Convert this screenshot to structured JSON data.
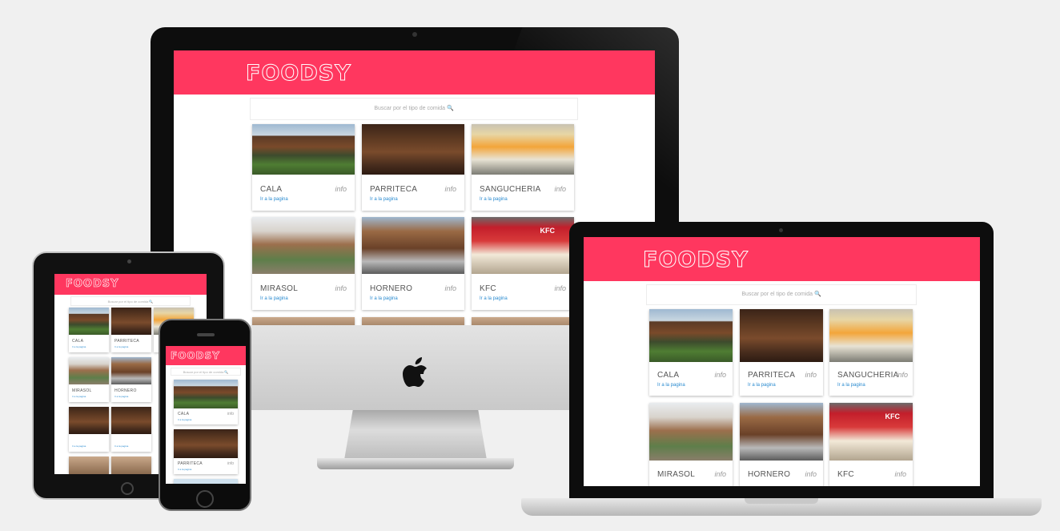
{
  "site": {
    "logo": "FOODSY",
    "search_placeholder": "Buscar por el tipo de comida 🔍",
    "link_label": "Ir a la pagina",
    "info_label": "info",
    "brand_color": "#ff375f",
    "link_color": "#2a8bd0"
  },
  "restaurants": [
    {
      "name": "CALA",
      "photo": "storefront-photo"
    },
    {
      "name": "PARRITECA",
      "photo": "interior-photo"
    },
    {
      "name": "SANGUCHERIA",
      "photo": "kiosk-photo"
    },
    {
      "name": "MIRASOL",
      "photo": "storefront-photo"
    },
    {
      "name": "HORNERO",
      "photo": "storefront-photo"
    },
    {
      "name": "KFC",
      "photo": "storefront-photo",
      "sign": "KFC"
    }
  ],
  "devices": [
    "imac",
    "macbook",
    "ipad",
    "iphone"
  ],
  "icons": {
    "camera": "camera-dot-icon",
    "apple": "apple-logo-icon",
    "home": "home-button-icon"
  }
}
